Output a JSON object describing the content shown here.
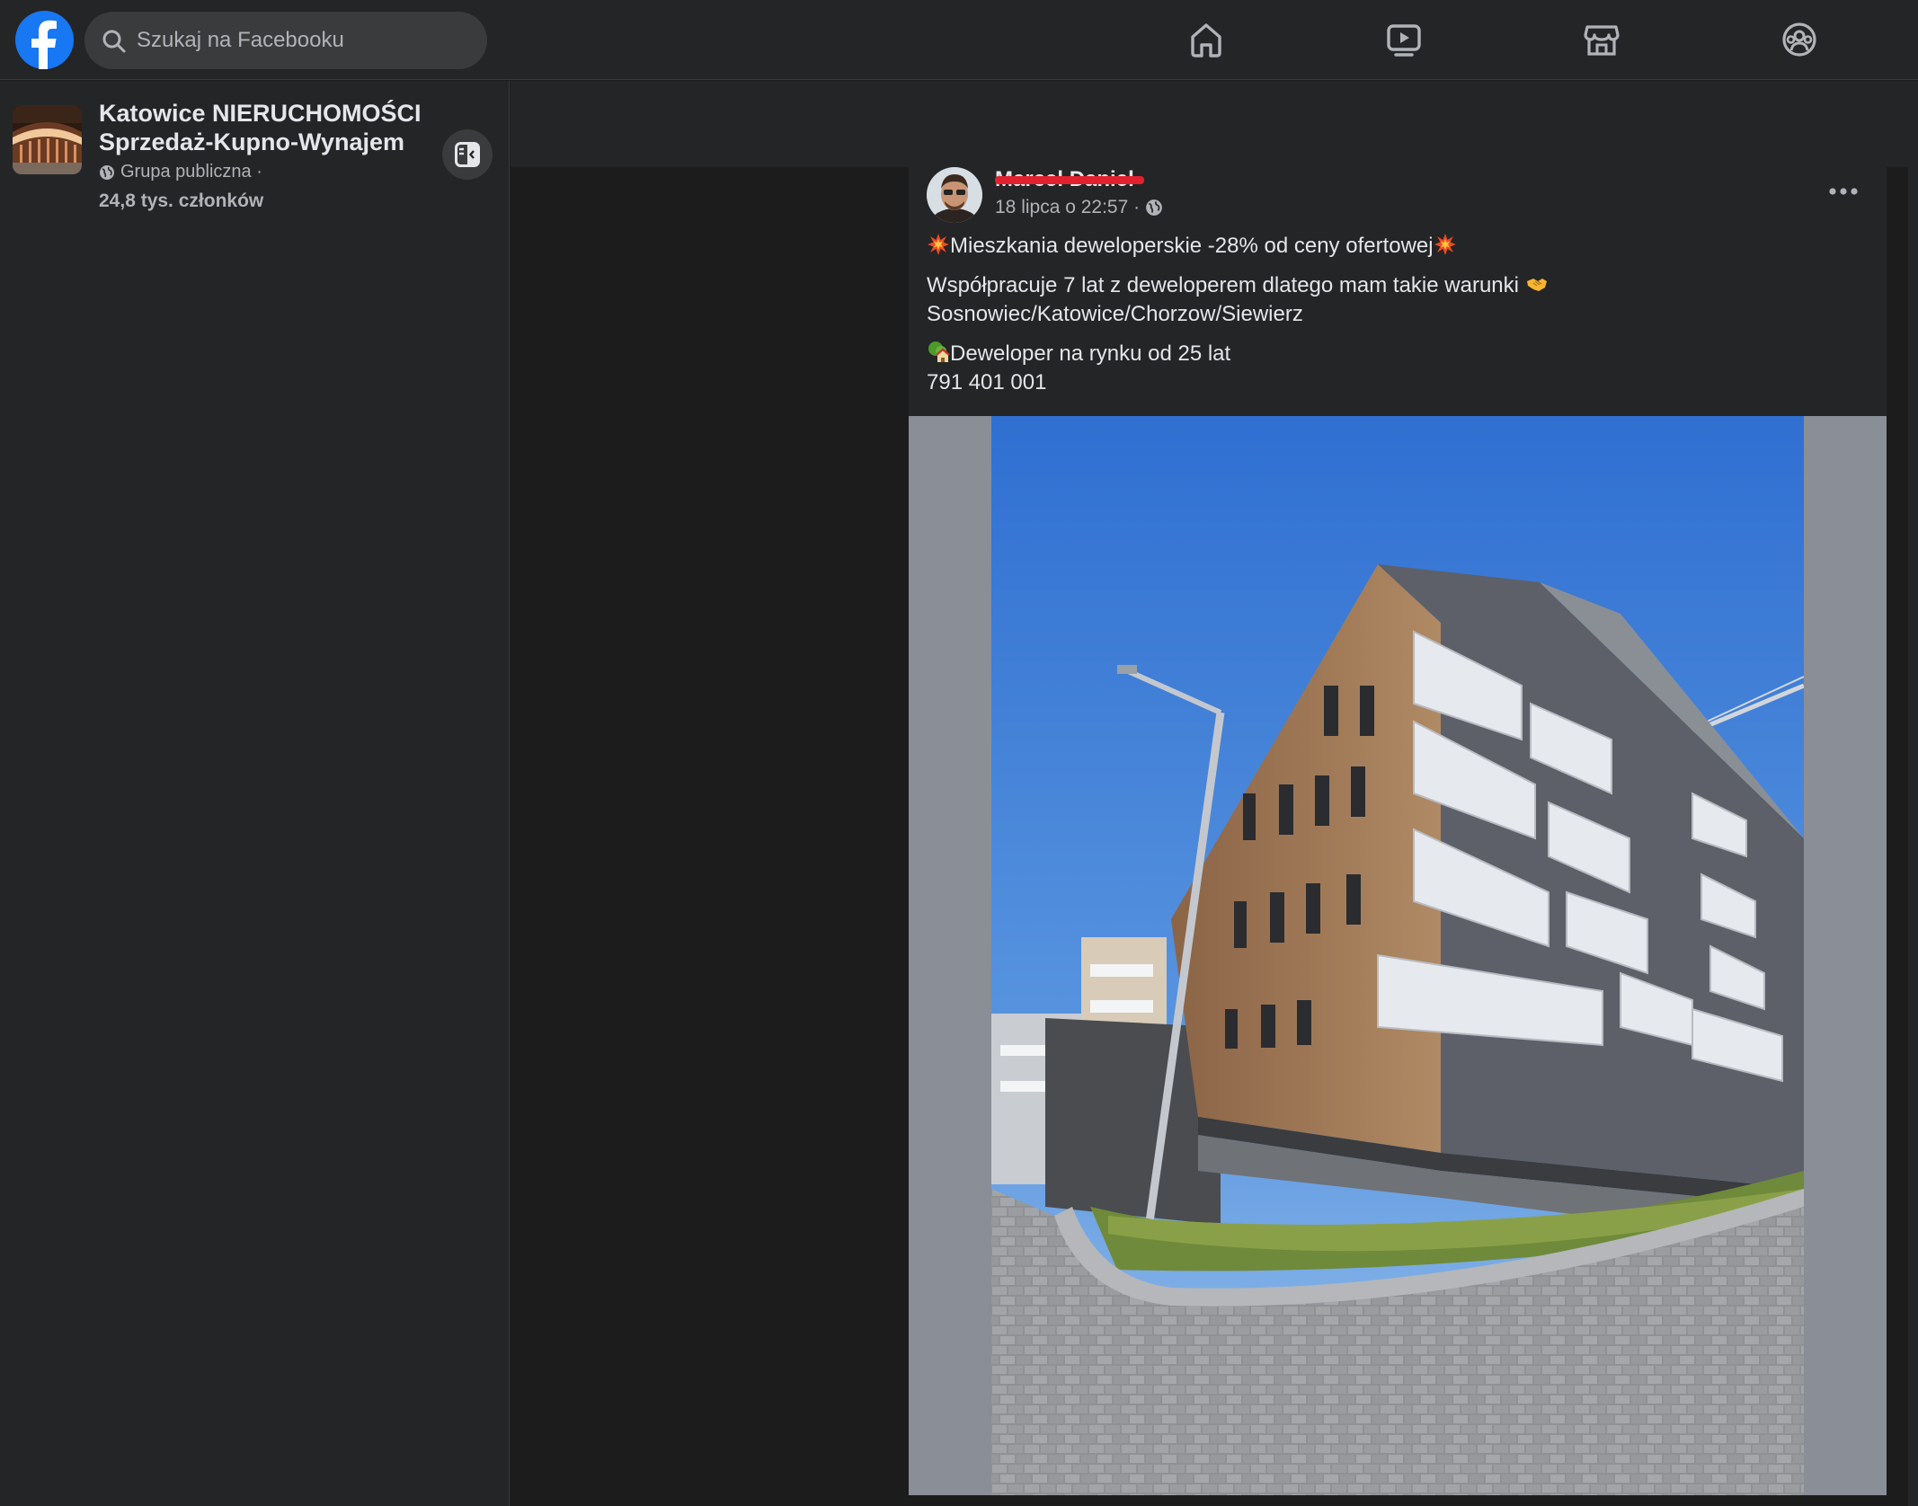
{
  "topbar": {
    "search_placeholder": "Szukaj na Facebooku",
    "nav": [
      "home-icon",
      "watch-icon",
      "marketplace-icon",
      "groups-icon"
    ]
  },
  "group": {
    "title": "Katowice NIERUCHOMOŚCI Sprzedaż-Kupno-Wynajem",
    "privacy": "Grupa publiczna ·",
    "members": "24,8 tys. członków"
  },
  "post": {
    "author": "Marcel Daniel",
    "timestamp": "18 lipca o 22:57 ·",
    "line1": "Mieszkania deweloperskie -28% od ceny ofertowej",
    "line2": "Współpracuje 7 lat z deweloperem dlatego mam takie warunki",
    "line3": "Sosnowiec/Katowice/Chorzow/Siewierz",
    "line4": "Deweloper na rynku od 25 lat",
    "line5": "791 401 001"
  },
  "colors": {
    "brand": "#1877f2",
    "background": "#1c1c1d",
    "surface": "#242526",
    "redaction": "#e3202d"
  }
}
